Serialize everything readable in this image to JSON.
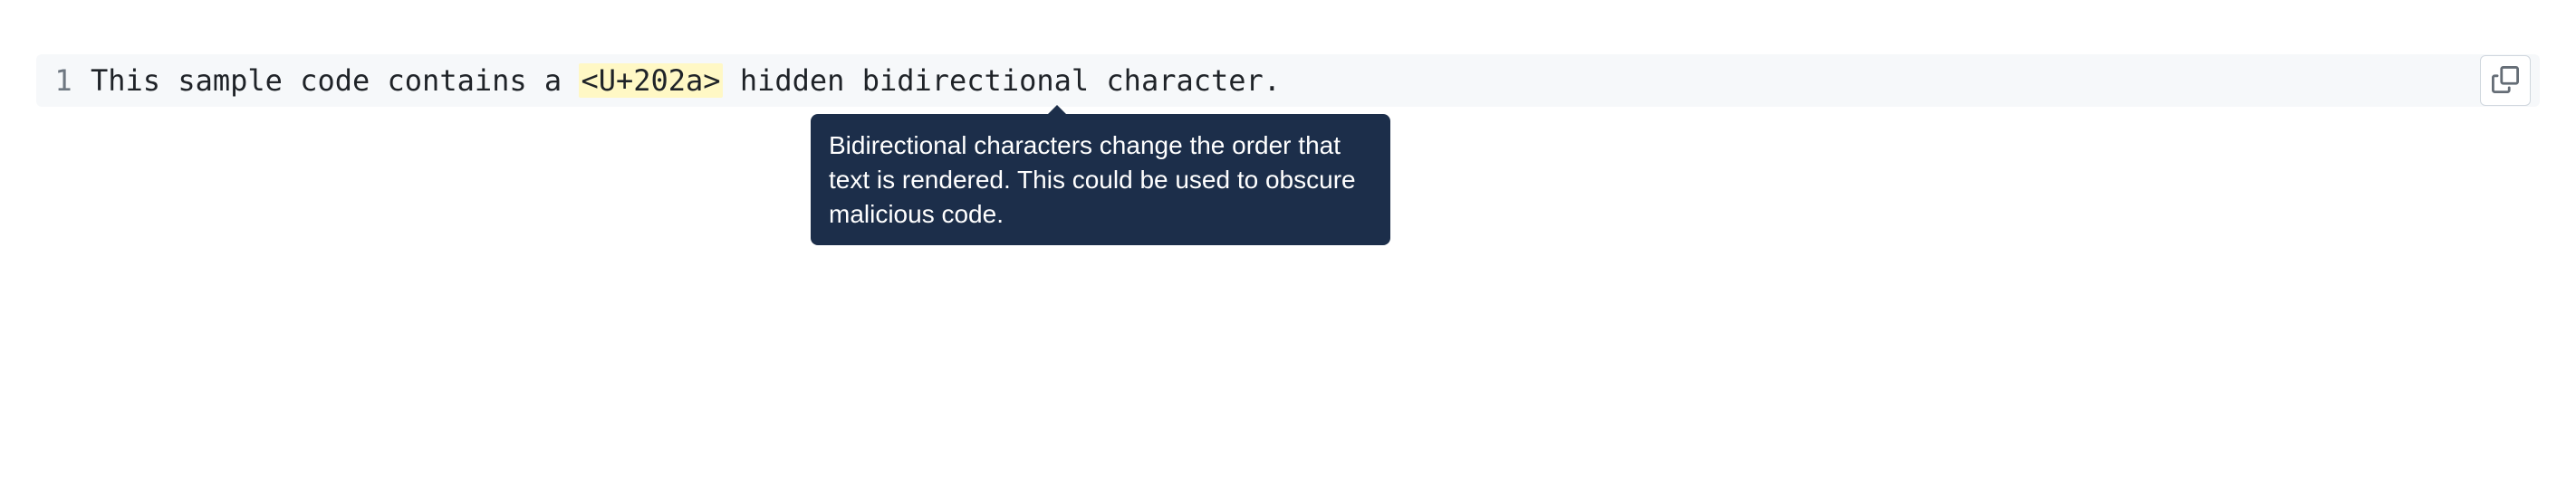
{
  "code": {
    "lineNumber": "1",
    "textBefore": "This sample code contains a ",
    "highlightedChar": "<U+202a>",
    "textAfter": " hidden bidirectional character."
  },
  "tooltip": {
    "text": "Bidirectional characters change the order that text is rendered. This could be used to obscure malicious code."
  }
}
